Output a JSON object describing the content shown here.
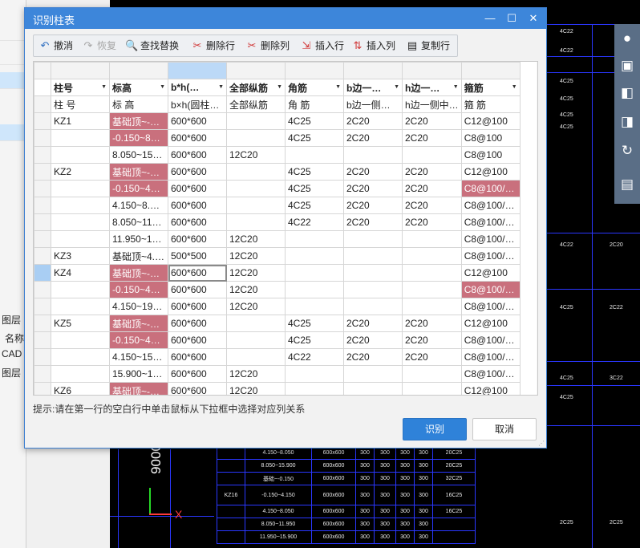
{
  "dialog": {
    "title": "识别柱表",
    "minimize": "—",
    "maximize": "☐",
    "close": "✕"
  },
  "toolbar": {
    "undo": "撤消",
    "redo": "恢复",
    "find_replace": "查找替换",
    "delete_row": "删除行",
    "delete_col": "删除列",
    "insert_row": "插入行",
    "insert_col": "插入列",
    "copy_row": "复制行"
  },
  "grid": {
    "headers": [
      "柱号",
      "标高",
      "b*h(…",
      "全部纵筋",
      "角筋",
      "b边一…",
      "h边一…",
      "箍筋"
    ],
    "sub_headers": [
      "柱 号",
      "标 高",
      "b×h(圆柱…",
      "全部纵筋",
      "角 筋",
      "b边一侧…",
      "h边一侧中…",
      "箍 筋"
    ],
    "rows": [
      [
        "KZ1",
        "基础顶~-…",
        "600*600",
        "",
        "4C25",
        "2C20",
        "2C20",
        "C12@100"
      ],
      [
        "",
        "-0.150~8…",
        "600*600",
        "",
        "4C25",
        "2C20",
        "2C20",
        "C8@100"
      ],
      [
        "",
        "8.050~15…",
        "600*600",
        "12C20",
        "",
        "",
        "",
        "C8@100"
      ],
      [
        "KZ2",
        "基础顶~-…",
        "600*600",
        "",
        "4C25",
        "2C20",
        "2C20",
        "C12@100"
      ],
      [
        "",
        "-0.150~4…",
        "600*600",
        "",
        "4C25",
        "2C20",
        "2C20",
        "C8@100/…"
      ],
      [
        "",
        "4.150~8.…",
        "600*600",
        "",
        "4C25",
        "2C20",
        "2C20",
        "C8@100/…"
      ],
      [
        "",
        "8.050~11…",
        "600*600",
        "",
        "4C22",
        "2C20",
        "2C20",
        "C8@100/…"
      ],
      [
        "",
        "11.950~1…",
        "600*600",
        "12C20",
        "",
        "",
        "",
        "C8@100/…"
      ],
      [
        "KZ3",
        "基础顶~4.…",
        "500*500",
        "12C20",
        "",
        "",
        "",
        "C8@100/…"
      ],
      [
        "KZ4",
        "基础顶~-…",
        "600*600",
        "12C20",
        "",
        "",
        "",
        "C12@100"
      ],
      [
        "",
        "-0.150~4…",
        "600*600",
        "12C20",
        "",
        "",
        "",
        "C8@100/…"
      ],
      [
        "",
        "4.150~19…",
        "600*600",
        "12C20",
        "",
        "",
        "",
        "C8@100/…"
      ],
      [
        "KZ5",
        "基础顶~-…",
        "600*600",
        "",
        "4C25",
        "2C20",
        "2C20",
        "C12@100"
      ],
      [
        "",
        "-0.150~4…",
        "600*600",
        "",
        "4C25",
        "2C20",
        "2C20",
        "C8@100/…"
      ],
      [
        "",
        "4.150~15…",
        "600*600",
        "",
        "4C22",
        "2C20",
        "2C20",
        "C8@100/…"
      ],
      [
        "",
        "15.900~1…",
        "600*600",
        "12C20",
        "",
        "",
        "",
        "C8@100/…"
      ],
      [
        "KZ6",
        "基础顶~-…",
        "600*600",
        "12C20",
        "",
        "",
        "",
        "C12@100"
      ]
    ]
  },
  "hint": "提示:请在第一行的空白行中单击鼠标从下拉框中选择对应列关系",
  "buttons": {
    "ok": "识别",
    "cancel": "取消"
  },
  "left_panel": {
    "items": [
      "图层",
      "名称",
      "CAD",
      "图层"
    ]
  },
  "cad": {
    "axis_x_label": "X",
    "axis_value": "9000",
    "right_labels": [
      "4C22",
      "4C22",
      "4C25",
      "4C25",
      "4C25",
      "4C25",
      "4C22",
      "2C20",
      "4C25",
      "2C22",
      "4C25",
      "3C22",
      "4C25",
      "2C25",
      "2C25"
    ],
    "table_rows": [
      [
        "",
        "4.150~8.050",
        "600x600",
        "300",
        "300",
        "300",
        "300",
        "20C25"
      ],
      [
        "",
        "8.050~15.900",
        "600x600",
        "300",
        "300",
        "300",
        "300",
        "20C25"
      ],
      [
        "",
        "基础~-0.150",
        "600x600",
        "300",
        "300",
        "300",
        "300",
        "32C25"
      ],
      [
        "KZ16",
        "-0.150~4.150",
        "600x600",
        "300",
        "300",
        "300",
        "300",
        "16C25"
      ],
      [
        "",
        "4.150~8.050",
        "600x600",
        "300",
        "300",
        "300",
        "300",
        "16C25"
      ],
      [
        "",
        "8.050~11.950",
        "600x600",
        "300",
        "300",
        "300",
        "300",
        ""
      ],
      [
        "",
        "11.950~15.900",
        "600x600",
        "300",
        "300",
        "300",
        "300",
        ""
      ]
    ]
  },
  "colors": {
    "accent": "#3d86da",
    "highlight_cell": "#c9707d",
    "cad_line": "#2a37ff"
  }
}
